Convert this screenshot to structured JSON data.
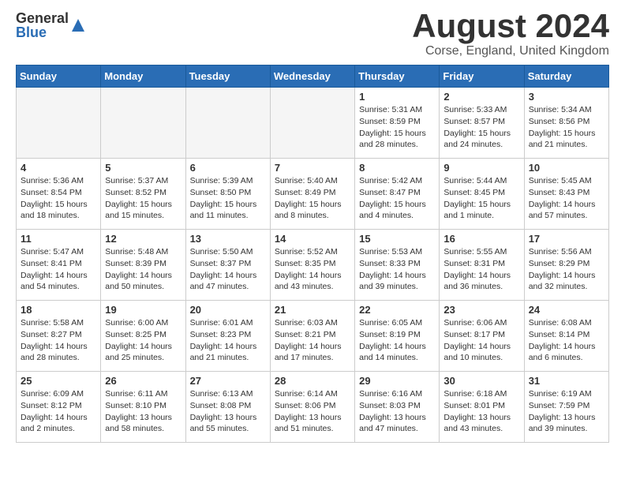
{
  "header": {
    "logo_general": "General",
    "logo_blue": "Blue",
    "month_year": "August 2024",
    "location": "Corse, England, United Kingdom"
  },
  "days_of_week": [
    "Sunday",
    "Monday",
    "Tuesday",
    "Wednesday",
    "Thursday",
    "Friday",
    "Saturday"
  ],
  "weeks": [
    [
      {
        "day": "",
        "info": ""
      },
      {
        "day": "",
        "info": ""
      },
      {
        "day": "",
        "info": ""
      },
      {
        "day": "",
        "info": ""
      },
      {
        "day": "1",
        "info": "Sunrise: 5:31 AM\nSunset: 8:59 PM\nDaylight: 15 hours and 28 minutes."
      },
      {
        "day": "2",
        "info": "Sunrise: 5:33 AM\nSunset: 8:57 PM\nDaylight: 15 hours and 24 minutes."
      },
      {
        "day": "3",
        "info": "Sunrise: 5:34 AM\nSunset: 8:56 PM\nDaylight: 15 hours and 21 minutes."
      }
    ],
    [
      {
        "day": "4",
        "info": "Sunrise: 5:36 AM\nSunset: 8:54 PM\nDaylight: 15 hours and 18 minutes."
      },
      {
        "day": "5",
        "info": "Sunrise: 5:37 AM\nSunset: 8:52 PM\nDaylight: 15 hours and 15 minutes."
      },
      {
        "day": "6",
        "info": "Sunrise: 5:39 AM\nSunset: 8:50 PM\nDaylight: 15 hours and 11 minutes."
      },
      {
        "day": "7",
        "info": "Sunrise: 5:40 AM\nSunset: 8:49 PM\nDaylight: 15 hours and 8 minutes."
      },
      {
        "day": "8",
        "info": "Sunrise: 5:42 AM\nSunset: 8:47 PM\nDaylight: 15 hours and 4 minutes."
      },
      {
        "day": "9",
        "info": "Sunrise: 5:44 AM\nSunset: 8:45 PM\nDaylight: 15 hours and 1 minute."
      },
      {
        "day": "10",
        "info": "Sunrise: 5:45 AM\nSunset: 8:43 PM\nDaylight: 14 hours and 57 minutes."
      }
    ],
    [
      {
        "day": "11",
        "info": "Sunrise: 5:47 AM\nSunset: 8:41 PM\nDaylight: 14 hours and 54 minutes."
      },
      {
        "day": "12",
        "info": "Sunrise: 5:48 AM\nSunset: 8:39 PM\nDaylight: 14 hours and 50 minutes."
      },
      {
        "day": "13",
        "info": "Sunrise: 5:50 AM\nSunset: 8:37 PM\nDaylight: 14 hours and 47 minutes."
      },
      {
        "day": "14",
        "info": "Sunrise: 5:52 AM\nSunset: 8:35 PM\nDaylight: 14 hours and 43 minutes."
      },
      {
        "day": "15",
        "info": "Sunrise: 5:53 AM\nSunset: 8:33 PM\nDaylight: 14 hours and 39 minutes."
      },
      {
        "day": "16",
        "info": "Sunrise: 5:55 AM\nSunset: 8:31 PM\nDaylight: 14 hours and 36 minutes."
      },
      {
        "day": "17",
        "info": "Sunrise: 5:56 AM\nSunset: 8:29 PM\nDaylight: 14 hours and 32 minutes."
      }
    ],
    [
      {
        "day": "18",
        "info": "Sunrise: 5:58 AM\nSunset: 8:27 PM\nDaylight: 14 hours and 28 minutes."
      },
      {
        "day": "19",
        "info": "Sunrise: 6:00 AM\nSunset: 8:25 PM\nDaylight: 14 hours and 25 minutes."
      },
      {
        "day": "20",
        "info": "Sunrise: 6:01 AM\nSunset: 8:23 PM\nDaylight: 14 hours and 21 minutes."
      },
      {
        "day": "21",
        "info": "Sunrise: 6:03 AM\nSunset: 8:21 PM\nDaylight: 14 hours and 17 minutes."
      },
      {
        "day": "22",
        "info": "Sunrise: 6:05 AM\nSunset: 8:19 PM\nDaylight: 14 hours and 14 minutes."
      },
      {
        "day": "23",
        "info": "Sunrise: 6:06 AM\nSunset: 8:17 PM\nDaylight: 14 hours and 10 minutes."
      },
      {
        "day": "24",
        "info": "Sunrise: 6:08 AM\nSunset: 8:14 PM\nDaylight: 14 hours and 6 minutes."
      }
    ],
    [
      {
        "day": "25",
        "info": "Sunrise: 6:09 AM\nSunset: 8:12 PM\nDaylight: 14 hours and 2 minutes."
      },
      {
        "day": "26",
        "info": "Sunrise: 6:11 AM\nSunset: 8:10 PM\nDaylight: 13 hours and 58 minutes."
      },
      {
        "day": "27",
        "info": "Sunrise: 6:13 AM\nSunset: 8:08 PM\nDaylight: 13 hours and 55 minutes."
      },
      {
        "day": "28",
        "info": "Sunrise: 6:14 AM\nSunset: 8:06 PM\nDaylight: 13 hours and 51 minutes."
      },
      {
        "day": "29",
        "info": "Sunrise: 6:16 AM\nSunset: 8:03 PM\nDaylight: 13 hours and 47 minutes."
      },
      {
        "day": "30",
        "info": "Sunrise: 6:18 AM\nSunset: 8:01 PM\nDaylight: 13 hours and 43 minutes."
      },
      {
        "day": "31",
        "info": "Sunrise: 6:19 AM\nSunset: 7:59 PM\nDaylight: 13 hours and 39 minutes."
      }
    ]
  ]
}
